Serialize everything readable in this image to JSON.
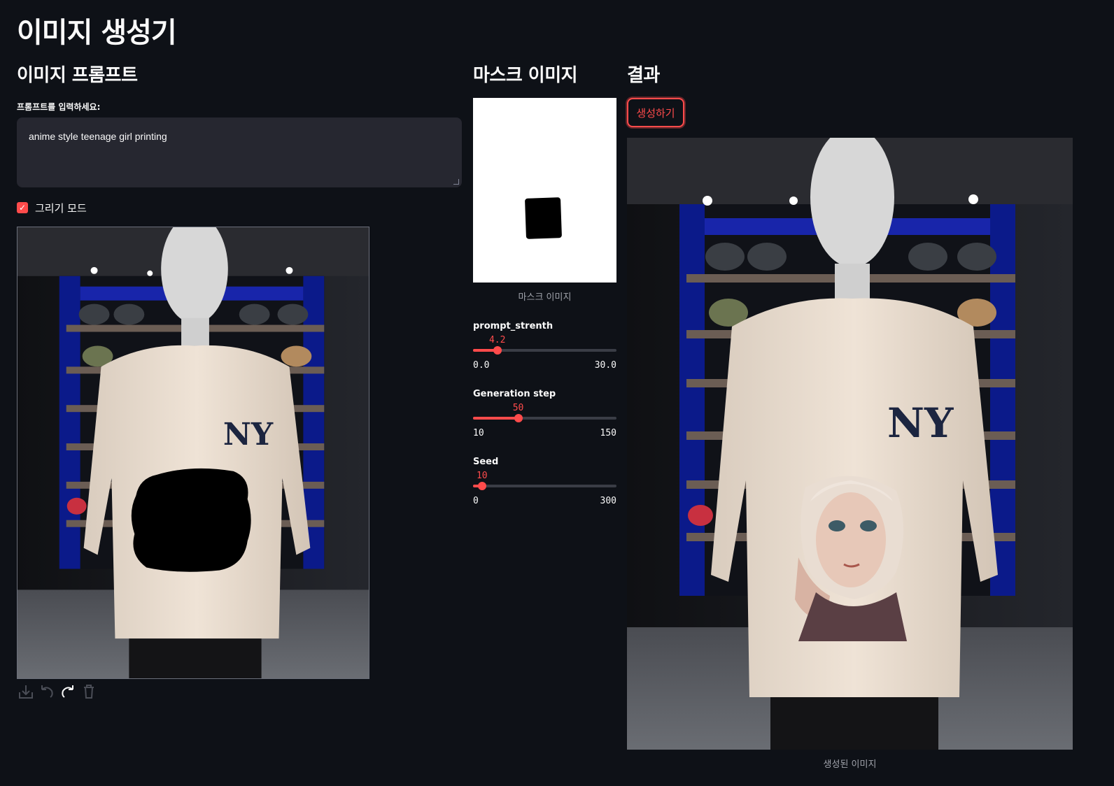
{
  "page": {
    "title": "이미지 생성기"
  },
  "prompt_section": {
    "heading": "이미지 프롬프트",
    "label": "프롬프트를 입력하세요:",
    "value": "anime style teenage girl printing",
    "draw_mode_label": "그리기 모드",
    "draw_mode_checked": true
  },
  "mask_section": {
    "heading": "마스크 이미지",
    "caption": "마스크 이미지"
  },
  "sliders": [
    {
      "label": "prompt_strenth",
      "value": "4.2",
      "min": "0.0",
      "max": "30.0",
      "fraction": 0.14
    },
    {
      "label": "Generation step",
      "value": "50",
      "min": "10",
      "max": "150",
      "fraction": 0.2857
    },
    {
      "label": "Seed",
      "value": "10",
      "min": "0",
      "max": "300",
      "fraction": 0.0333
    }
  ],
  "result_section": {
    "heading": "결과",
    "button_label": "생성하기",
    "caption": "생성된 이미지"
  },
  "colors": {
    "accent": "#ff4b4b",
    "background": "#0e1117",
    "input_bg": "#262730"
  }
}
